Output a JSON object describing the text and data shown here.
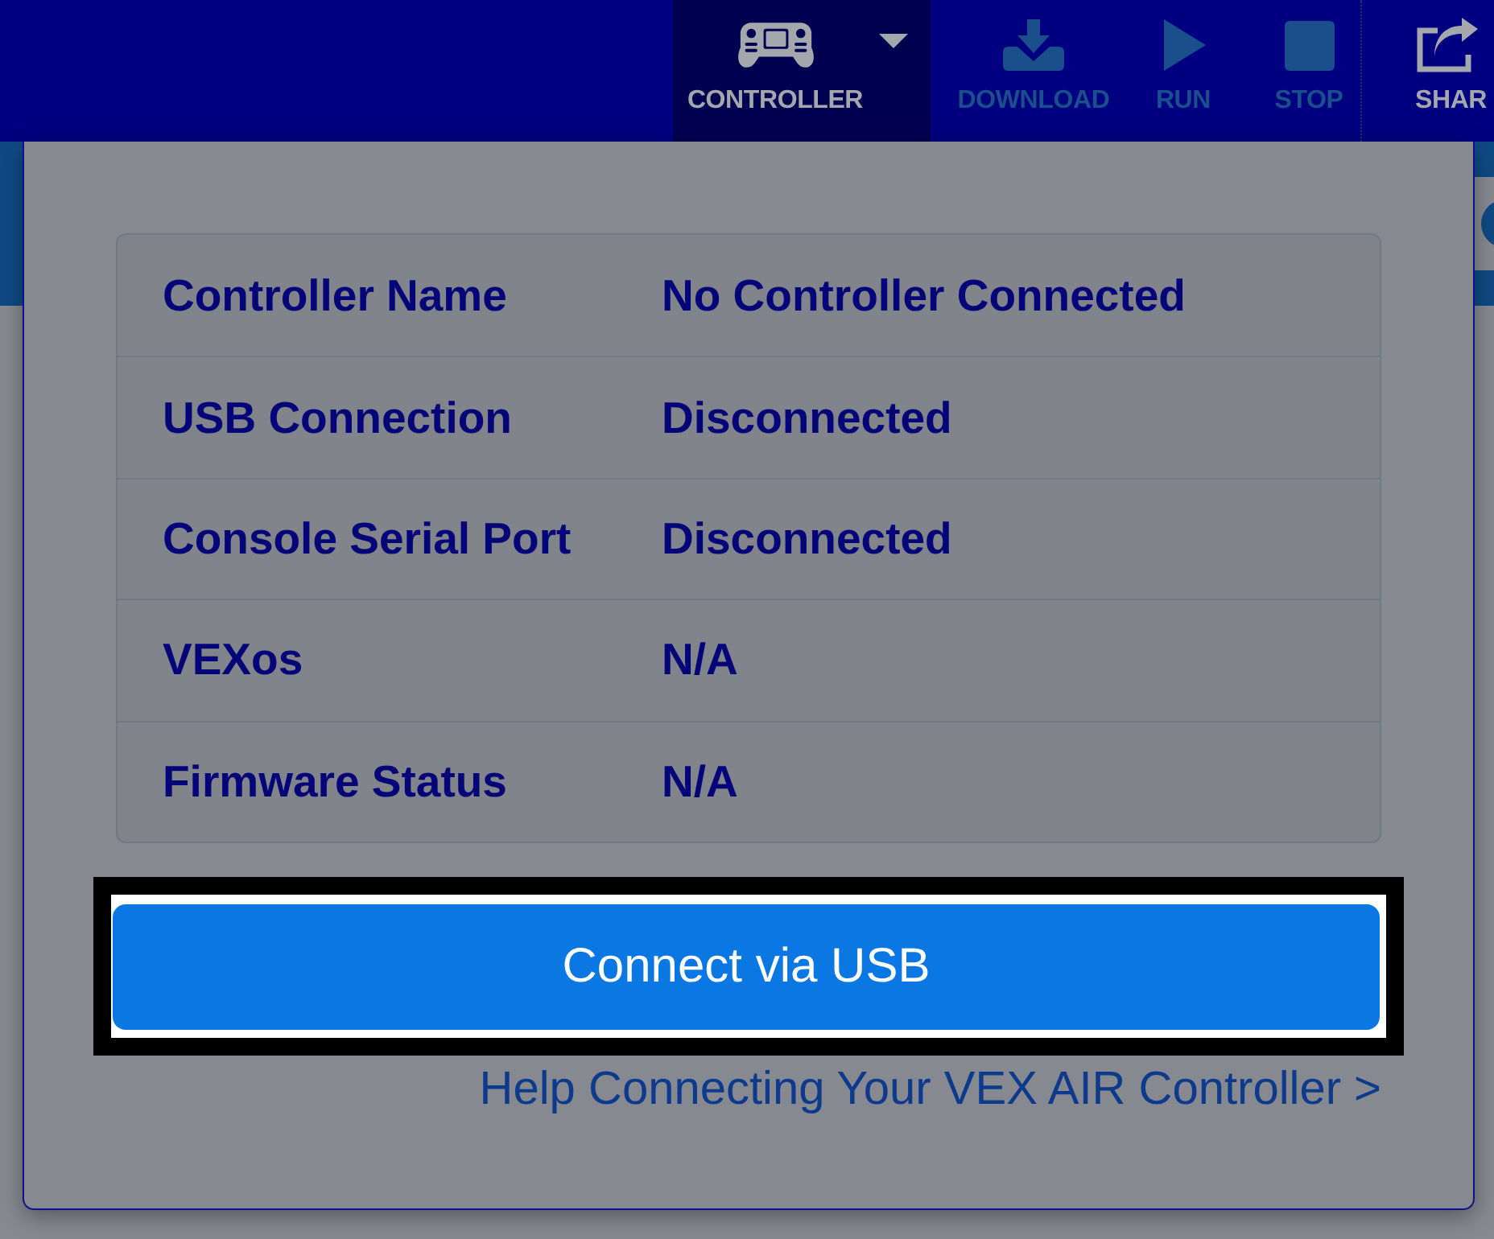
{
  "toolbar": {
    "items": [
      {
        "kind": "controller",
        "label": "CONTROLLER",
        "selected": true,
        "disabled": false,
        "dropdown": true
      },
      {
        "kind": "download",
        "label": "DOWNLOAD",
        "selected": false,
        "disabled": true,
        "dropdown": false
      },
      {
        "kind": "run",
        "label": "RUN",
        "selected": false,
        "disabled": true,
        "dropdown": false
      },
      {
        "kind": "stop",
        "label": "STOP",
        "selected": false,
        "disabled": true,
        "dropdown": false
      },
      {
        "kind": "share",
        "label": "SHAR",
        "selected": false,
        "disabled": false,
        "dropdown": false
      }
    ]
  },
  "controller_panel": {
    "rows": [
      {
        "label": "Controller Name",
        "value": "No Controller Connected"
      },
      {
        "label": "USB Connection",
        "value": "Disconnected"
      },
      {
        "label": "Console Serial Port",
        "value": "Disconnected"
      },
      {
        "label": "VEXos",
        "value": "N/A"
      },
      {
        "label": "Firmware Status",
        "value": "N/A"
      }
    ],
    "connect_button": {
      "label": "Connect via USB",
      "focused": true
    },
    "help_link": "Help Connecting Your VEX AIR Controller >"
  }
}
